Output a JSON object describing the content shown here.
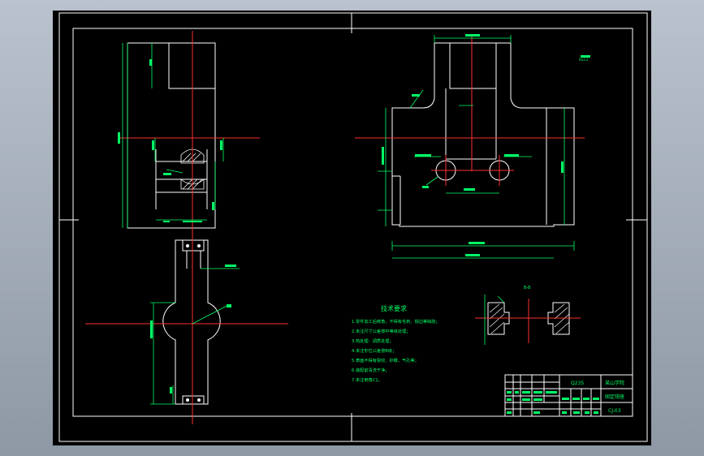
{
  "drawing": {
    "tech_requirements": {
      "title": "技术要求",
      "items": [
        "1.零件加工后倒角，不得有毛刺、锐边等缺陷；",
        "2.未注尺寸公差按中等级处理；",
        "3.热处理：调质处理；",
        "4.未注形位公差按B级；",
        "5.表面不得有裂纹、砂眼、气孔等；",
        "6.装配前清洗干净；",
        "7.未注倒角C1。"
      ]
    },
    "title_block": {
      "material": "Q235",
      "company": "某山学院",
      "drawing_name": "固定钳座",
      "drawing_number": "CJ-03"
    },
    "section_label": "B-B",
    "roughness_note": "Ra3.2"
  }
}
